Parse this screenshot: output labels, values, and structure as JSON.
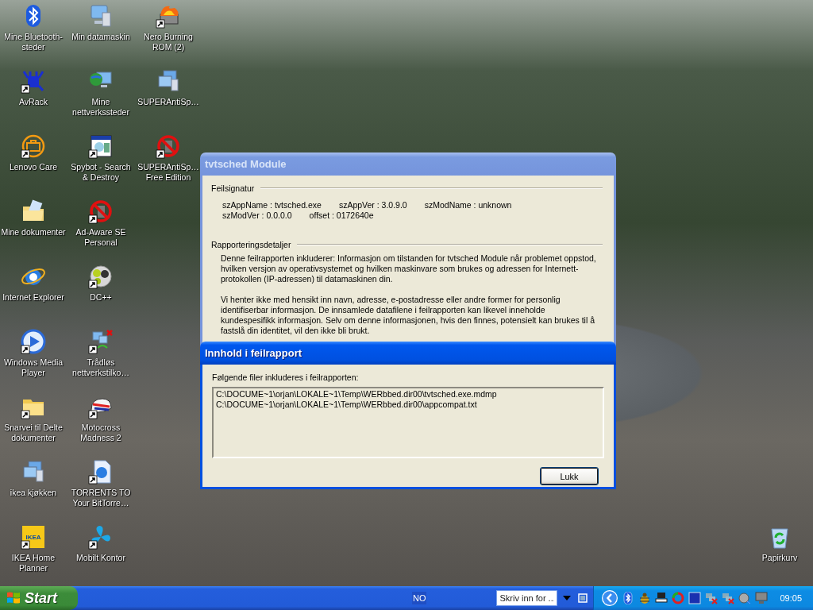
{
  "desktop": {
    "icons": [
      {
        "label": "Mine Bluetooth-steder",
        "kind": "bluetooth",
        "shortcut": false
      },
      {
        "label": "AvRack",
        "kind": "chip",
        "shortcut": true
      },
      {
        "label": "Lenovo Care",
        "kind": "toolbox",
        "shortcut": true
      },
      {
        "label": "Mine dokumenter",
        "kind": "docfolder",
        "shortcut": false
      },
      {
        "label": "Internet Explorer",
        "kind": "browser",
        "shortcut": false
      },
      {
        "label": "Windows Media Player",
        "kind": "play",
        "shortcut": true
      },
      {
        "label": "Snarvei til Delte dokumenter",
        "kind": "folder",
        "shortcut": true
      },
      {
        "label": "ikea kjøkken",
        "kind": "computers",
        "shortcut": false
      },
      {
        "label": "IKEA Home Planner",
        "kind": "logo",
        "logo": "IKEA",
        "shortcut": true
      },
      {
        "label": "Min datamaskin",
        "kind": "computer",
        "shortcut": false
      },
      {
        "label": "Mine nettverkssteder",
        "kind": "network",
        "shortcut": false
      },
      {
        "label": "Spybot - Search & Destroy",
        "kind": "window",
        "shortcut": true
      },
      {
        "label": "Ad-Aware SE Personal",
        "kind": "nosign",
        "shortcut": true
      },
      {
        "label": "DC++",
        "kind": "dots",
        "shortcut": true
      },
      {
        "label": "Trådløs nettverkstilko…",
        "kind": "wireless",
        "shortcut": true
      },
      {
        "label": "Motocross Madness 2",
        "kind": "helmet",
        "shortcut": true
      },
      {
        "label": "TORRENTS  TO Your BitTorre…",
        "kind": "webdoc",
        "shortcut": true
      },
      {
        "label": "Mobilt Kontor",
        "kind": "propeller",
        "shortcut": true
      },
      {
        "label": "Nero Burning ROM (2)",
        "kind": "flame",
        "shortcut": true
      },
      {
        "label": "SUPERAntiSp…",
        "kind": "computers",
        "shortcut": false
      },
      {
        "label": "SUPERAntiSp… Free Edition",
        "kind": "nosign",
        "shortcut": true
      }
    ],
    "trash": {
      "label": "Papirkurv"
    }
  },
  "error_window": {
    "title": "tvtsched Module",
    "active": false,
    "signature": {
      "heading": "Feilsignatur",
      "rows": [
        [
          "szAppName : tvtsched.exe",
          "szAppVer : 3.0.9.0",
          "szModName : unknown"
        ],
        [
          "szModVer : 0.0.0.0",
          "offset : 0172640e"
        ]
      ]
    },
    "details": {
      "heading": "Rapporteringsdetaljer",
      "paragraphs": [
        "Denne feilrapporten inkluderer: Informasjon om tilstanden for tvtsched Module når problemet oppstod, hvilken versjon av operativsystemet og hvilken maskinvare som brukes og adressen for Internett-protokollen (IP-adressen) til datamaskinen din.",
        "Vi henter ikke med hensikt inn navn, adresse, e-postadresse eller andre former for personlig identifiserbar informasjon. De innsamlede datafilene i feilrapporten kan likevel inneholde kundespesifikk informasjon. Selv om denne informasjonen, hvis den finnes, potensielt kan brukes til å fastslå din identitet, vil den ikke bli brukt."
      ]
    }
  },
  "contents_window": {
    "title": "Innhold i feilrapport",
    "active": true,
    "intro": "Følgende filer inkluderes i feilrapporten:",
    "files": [
      "C:\\DOCUME~1\\orjan\\LOKALE~1\\Temp\\WERbbed.dir00\\tvtsched.exe.mdmp",
      "C:\\DOCUME~1\\orjan\\LOKALE~1\\Temp\\WERbbed.dir00\\appcompat.txt"
    ],
    "close_button": "Lukk"
  },
  "taskbar": {
    "start": "Start",
    "language": "NO",
    "search": {
      "placeholder": "Skriv inn for ..."
    },
    "clock": "09:05"
  }
}
